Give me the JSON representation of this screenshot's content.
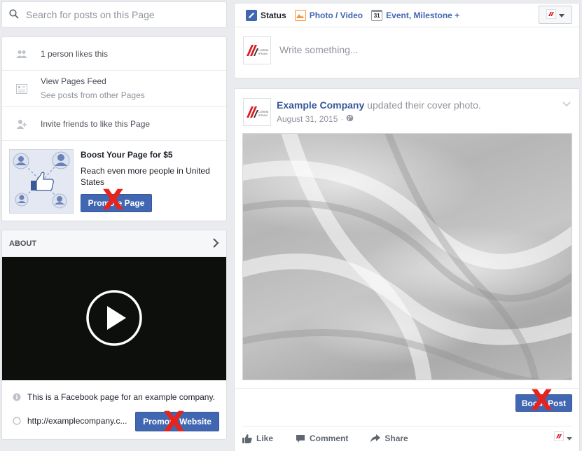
{
  "search": {
    "placeholder": "Search for posts on this Page"
  },
  "info": {
    "likes": "1 person likes this",
    "pages_feed_title": "View Pages Feed",
    "pages_feed_sub": "See posts from other Pages",
    "invite": "Invite friends to like this Page"
  },
  "boost": {
    "title": "Boost Your Page for $5",
    "description": "Reach even more people in United States",
    "button": "Promote Page"
  },
  "about": {
    "heading": "ABOUT",
    "description": "This is a Facebook page for an example company.",
    "website": "http://examplecompany.c...",
    "website_button": "Promote Website"
  },
  "composer": {
    "tabs": [
      {
        "label": "Status"
      },
      {
        "label": "Photo / Video"
      },
      {
        "label": "Event, Milestone +",
        "calendar_day": "31"
      }
    ],
    "placeholder": "Write something..."
  },
  "post": {
    "author": "Example Company",
    "action": "updated their cover photo.",
    "date": "August 31, 2015",
    "date_sep": "·",
    "boost_button": "Boost Post",
    "actions": [
      {
        "label": "Like"
      },
      {
        "label": "Comment"
      },
      {
        "label": "Share"
      }
    ]
  },
  "logo": {
    "line1": "LOREM",
    "line2": "IPSUM"
  },
  "annotations": {
    "x_mark": "X"
  },
  "colors": {
    "brand_blue": "#4267b2",
    "link_blue": "#365899",
    "red_x": "#e8231a"
  }
}
